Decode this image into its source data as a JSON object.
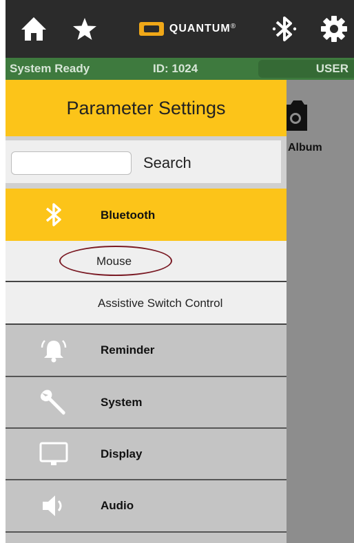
{
  "topbar": {
    "icons": [
      "home-icon",
      "star-icon",
      "quantum-logo",
      "bluetooth-icon",
      "gear-icon"
    ],
    "logo_text": "QUANTUM",
    "logo_mark": "®"
  },
  "status": {
    "state": "System Ready",
    "id": "ID: 1024",
    "user": "USER"
  },
  "background": {
    "album_label": "Album"
  },
  "drawer": {
    "title": "Parameter Settings",
    "search": {
      "placeholder": "",
      "label": "Search"
    },
    "items": [
      {
        "label": "Bluetooth",
        "icon": "bluetooth-icon",
        "selected": true
      },
      {
        "label": "Mouse",
        "sub": true,
        "highlighted": true
      },
      {
        "label": "Assistive Switch Control",
        "sub": true
      },
      {
        "label": "Reminder",
        "icon": "bell-icon"
      },
      {
        "label": "System",
        "icon": "wrench-icon"
      },
      {
        "label": "Display",
        "icon": "monitor-icon"
      },
      {
        "label": "Audio",
        "icon": "speaker-icon"
      }
    ]
  },
  "colors": {
    "accent": "#fcc419",
    "topbar": "#2b2b2b",
    "status": "#3e7a3e",
    "highlight_oval": "#7a1a24"
  }
}
